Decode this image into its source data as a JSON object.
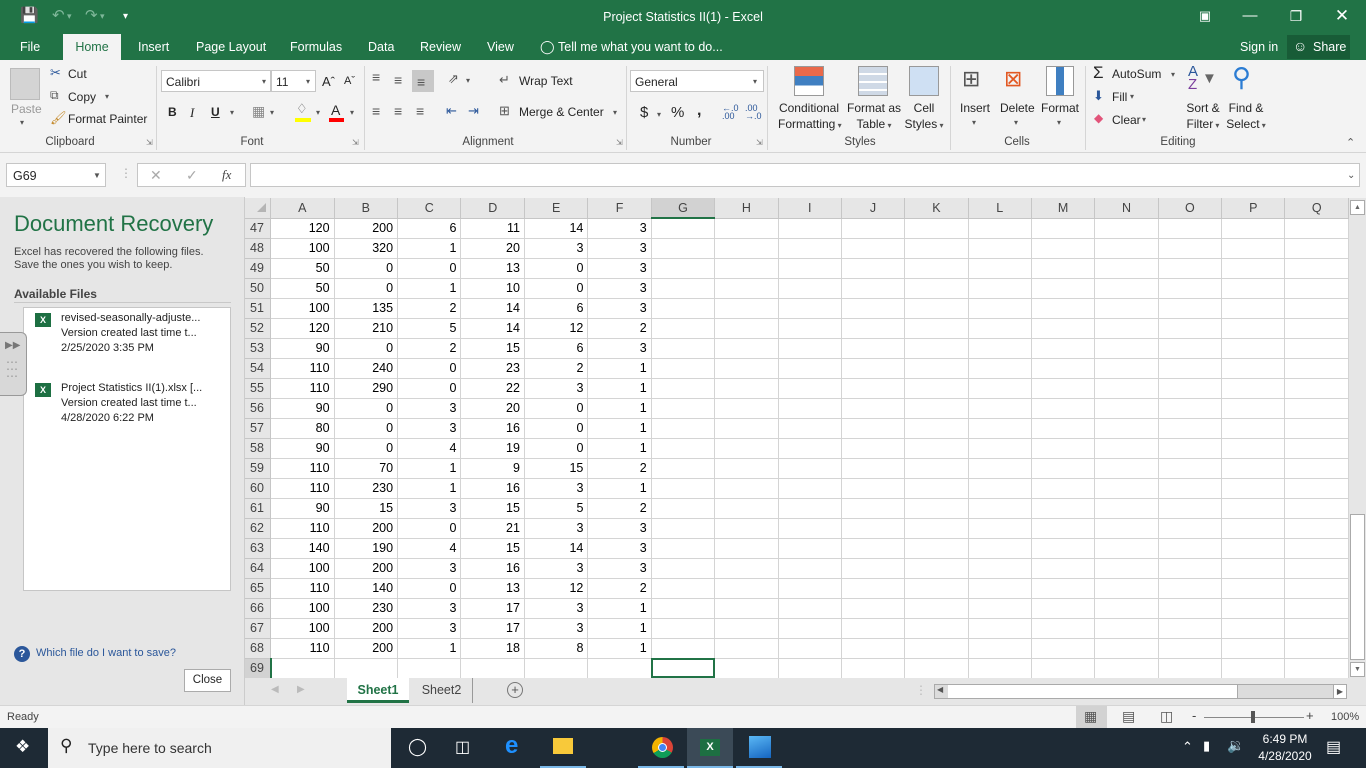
{
  "window": {
    "title": "Project Statistics II(1)  -  Excel",
    "qat": {
      "save_icon": "save-icon",
      "undo_icon": "undo-icon",
      "redo_icon": "redo-icon",
      "customize_icon": "customize-qat-icon"
    },
    "controls": {
      "ribbon_display": "ribbon-display-options-icon",
      "minimize": "minimize-icon",
      "restore": "restore-icon",
      "close": "close-icon"
    }
  },
  "tabs": [
    {
      "label": "File"
    },
    {
      "label": "Home",
      "active": true
    },
    {
      "label": "Insert"
    },
    {
      "label": "Page Layout"
    },
    {
      "label": "Formulas"
    },
    {
      "label": "Data"
    },
    {
      "label": "Review"
    },
    {
      "label": "View"
    }
  ],
  "tell_me": "Tell me what you want to do...",
  "sign_in": "Sign in",
  "share": "Share",
  "ribbon": {
    "clipboard": {
      "label": "Clipboard",
      "paste": "Paste",
      "cut": "Cut",
      "copy": "Copy",
      "format_painter": "Format Painter"
    },
    "font": {
      "label": "Font",
      "font_name": "Calibri",
      "font_size": "11",
      "bold": "B",
      "italic": "I",
      "underline": "U",
      "highlight_color": "#ffff00",
      "font_color": "#ff0000"
    },
    "alignment": {
      "label": "Alignment",
      "wrap_text": "Wrap Text",
      "merge_center": "Merge & Center"
    },
    "number": {
      "label": "Number",
      "format": "General",
      "currency": "$",
      "percent": "%",
      "comma": ","
    },
    "styles": {
      "label": "Styles",
      "conditional_formatting": [
        "Conditional",
        "Formatting"
      ],
      "format_as_table": [
        "Format as",
        "Table"
      ],
      "cell_styles": [
        "Cell",
        "Styles"
      ]
    },
    "cells": {
      "label": "Cells",
      "insert": "Insert",
      "delete": "Delete",
      "format": "Format"
    },
    "editing": {
      "label": "Editing",
      "autosum": "AutoSum",
      "fill": "Fill",
      "clear": "Clear",
      "sort_filter": [
        "Sort &",
        "Filter"
      ],
      "find_select": [
        "Find &",
        "Select"
      ]
    }
  },
  "formula_bar": {
    "name_box": "G69",
    "fx": "fx",
    "value": ""
  },
  "recovery": {
    "title": "Document Recovery",
    "description_line1": "Excel has recovered the following files.",
    "description_line2": "Save the ones you wish to keep.",
    "available_files": "Available Files",
    "files": [
      {
        "name": "revised-seasonally-adjuste...",
        "desc": "Version created last time t...",
        "date": "2/25/2020 3:35 PM"
      },
      {
        "name": "Project Statistics II(1).xlsx  [...",
        "desc": "Version created last time t...",
        "date": "4/28/2020 6:22 PM"
      }
    ],
    "help_link": "Which file do I want to save?",
    "close": "Close"
  },
  "sheet": {
    "columns": [
      "A",
      "B",
      "C",
      "D",
      "E",
      "F",
      "G",
      "H",
      "I",
      "J",
      "K",
      "L",
      "M",
      "N",
      "O",
      "P",
      "Q"
    ],
    "selected_column": "G",
    "selected_row": "69",
    "rows": [
      {
        "n": "47",
        "cells": [
          "120",
          "200",
          "6",
          "11",
          "14",
          "3"
        ]
      },
      {
        "n": "48",
        "cells": [
          "100",
          "320",
          "1",
          "20",
          "3",
          "3"
        ]
      },
      {
        "n": "49",
        "cells": [
          "50",
          "0",
          "0",
          "13",
          "0",
          "3"
        ]
      },
      {
        "n": "50",
        "cells": [
          "50",
          "0",
          "1",
          "10",
          "0",
          "3"
        ]
      },
      {
        "n": "51",
        "cells": [
          "100",
          "135",
          "2",
          "14",
          "6",
          "3"
        ]
      },
      {
        "n": "52",
        "cells": [
          "120",
          "210",
          "5",
          "14",
          "12",
          "2"
        ]
      },
      {
        "n": "53",
        "cells": [
          "90",
          "0",
          "2",
          "15",
          "6",
          "3"
        ]
      },
      {
        "n": "54",
        "cells": [
          "110",
          "240",
          "0",
          "23",
          "2",
          "1"
        ]
      },
      {
        "n": "55",
        "cells": [
          "110",
          "290",
          "0",
          "22",
          "3",
          "1"
        ]
      },
      {
        "n": "56",
        "cells": [
          "90",
          "0",
          "3",
          "20",
          "0",
          "1"
        ]
      },
      {
        "n": "57",
        "cells": [
          "80",
          "0",
          "3",
          "16",
          "0",
          "1"
        ]
      },
      {
        "n": "58",
        "cells": [
          "90",
          "0",
          "4",
          "19",
          "0",
          "1"
        ]
      },
      {
        "n": "59",
        "cells": [
          "110",
          "70",
          "1",
          "9",
          "15",
          "2"
        ]
      },
      {
        "n": "60",
        "cells": [
          "110",
          "230",
          "1",
          "16",
          "3",
          "1"
        ]
      },
      {
        "n": "61",
        "cells": [
          "90",
          "15",
          "3",
          "15",
          "5",
          "2"
        ]
      },
      {
        "n": "62",
        "cells": [
          "110",
          "200",
          "0",
          "21",
          "3",
          "3"
        ]
      },
      {
        "n": "63",
        "cells": [
          "140",
          "190",
          "4",
          "15",
          "14",
          "3"
        ]
      },
      {
        "n": "64",
        "cells": [
          "100",
          "200",
          "3",
          "16",
          "3",
          "3"
        ]
      },
      {
        "n": "65",
        "cells": [
          "110",
          "140",
          "0",
          "13",
          "12",
          "2"
        ]
      },
      {
        "n": "66",
        "cells": [
          "100",
          "230",
          "3",
          "17",
          "3",
          "1"
        ]
      },
      {
        "n": "67",
        "cells": [
          "100",
          "200",
          "3",
          "17",
          "3",
          "1"
        ]
      },
      {
        "n": "68",
        "cells": [
          "110",
          "200",
          "1",
          "18",
          "8",
          "1"
        ]
      },
      {
        "n": "69",
        "cells": [
          "",
          "",
          "",
          "",
          "",
          ""
        ]
      }
    ],
    "sheet_tabs": [
      {
        "label": "Sheet1",
        "active": true
      },
      {
        "label": "Sheet2"
      }
    ]
  },
  "status": {
    "text": "Ready",
    "zoom": "100%",
    "zoom_level": 100
  },
  "taskbar": {
    "search_placeholder": "Type here to search",
    "time": "6:49 PM",
    "date": "4/28/2020"
  },
  "colors": {
    "accent": "#217346",
    "taskbar": "#1e2a35",
    "link": "#2b579a"
  }
}
